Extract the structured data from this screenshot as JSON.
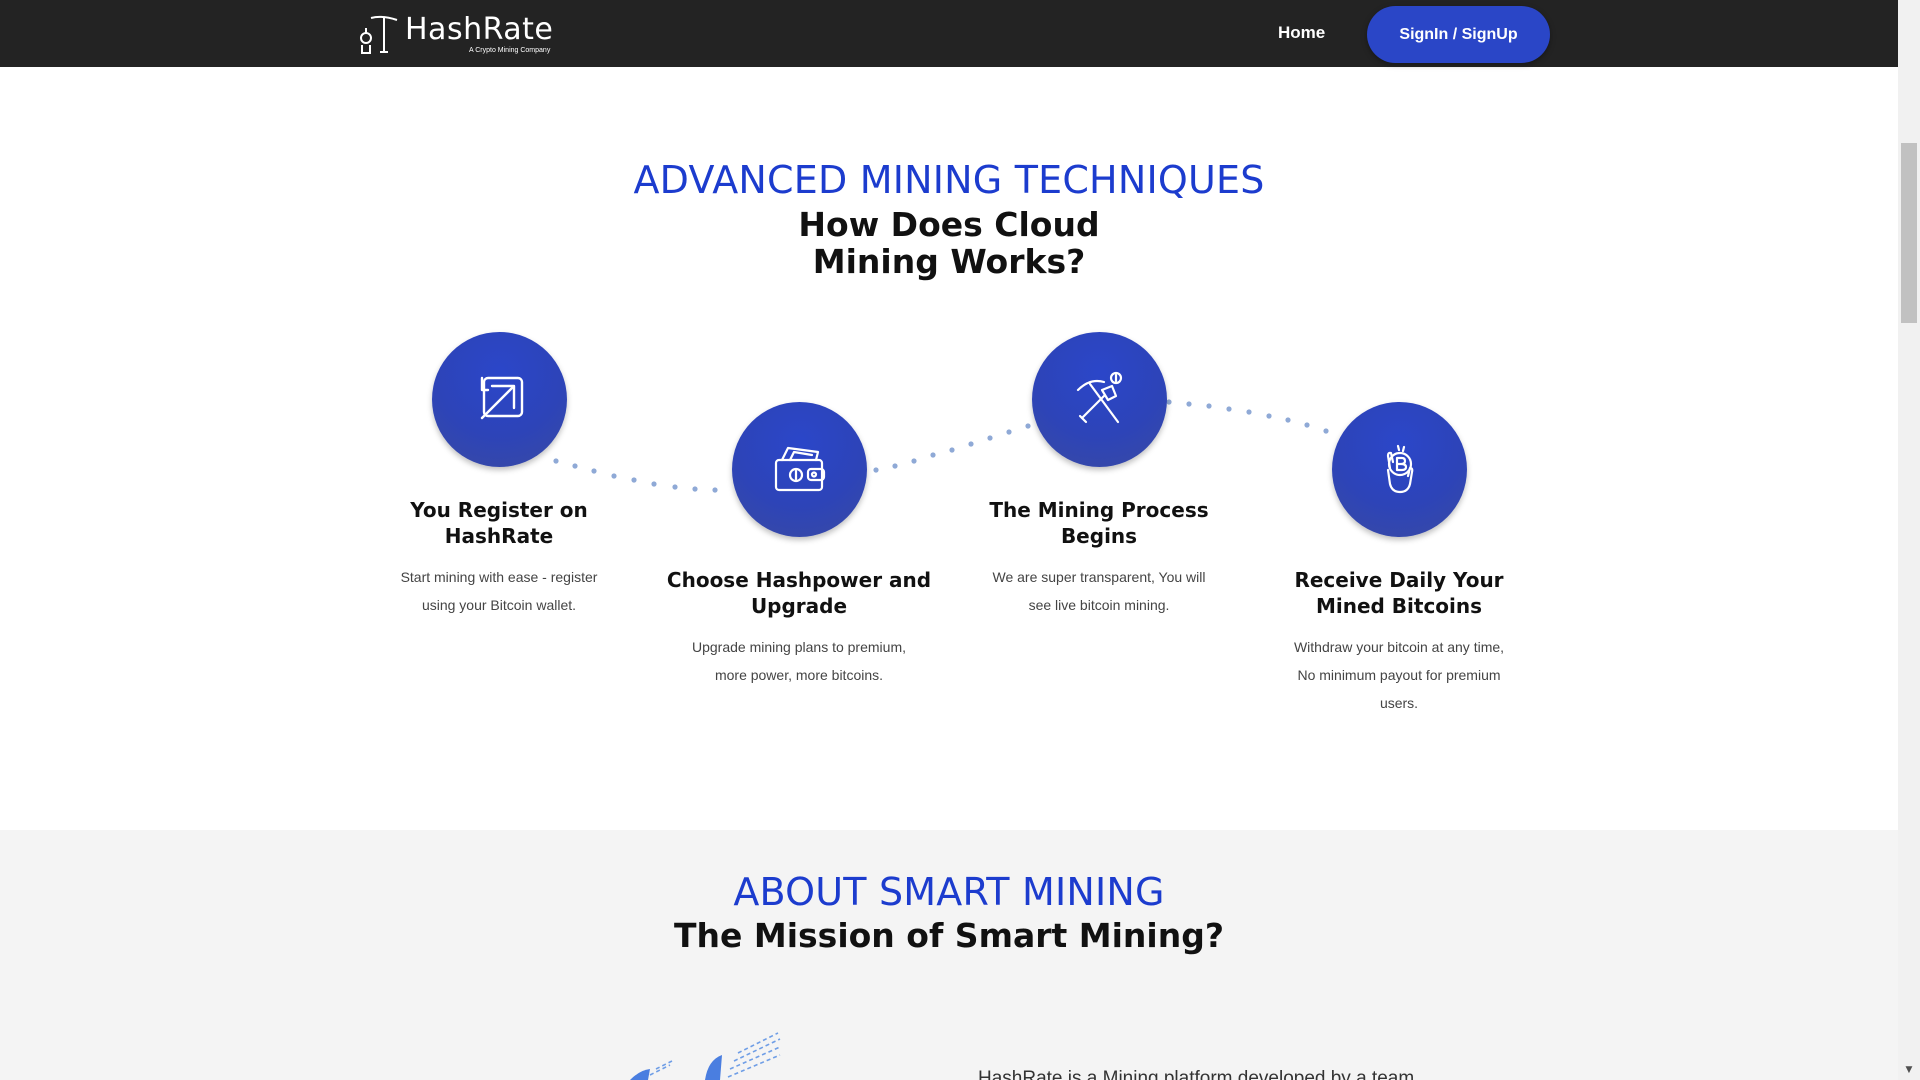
{
  "header": {
    "logo_title": "HashRate",
    "logo_tagline": "A Crypto Mining Company",
    "nav_home": "Home",
    "nav_signin": "SignIn / SignUp"
  },
  "how_it_works": {
    "kicker": "ADVANCED MINING TECHNIQUES",
    "heading_line1": "How Does Cloud",
    "heading_line2": "Mining Works?",
    "steps": [
      {
        "icon": "register-arrow-icon",
        "title": "You Register on HashRate",
        "desc": "Start mining with ease - register using your Bitcoin wallet."
      },
      {
        "icon": "wallet-icon",
        "title": "Choose Hashpower and Upgrade",
        "desc": "Upgrade mining plans to premium, more power, more bitcoins."
      },
      {
        "icon": "pickaxe-shovel-icon",
        "title": "The Mining Process Begins",
        "desc": "We are super transparent, You will see live bitcoin mining."
      },
      {
        "icon": "hand-bitcoin-icon",
        "title": "Receive Daily Your Mined Bitcoins",
        "desc": "Withdraw your bitcoin at any time, No minimum payout for premium users."
      }
    ]
  },
  "about": {
    "kicker": "ABOUT SMART MINING",
    "heading": "The Mission of Smart Mining?",
    "text_partial": "HashRate is a Mining platform developed by a team"
  },
  "colors": {
    "accent": "#1c3cce",
    "header_bg": "#232323",
    "button_bg": "#2a46c7",
    "dots": "#8fa9d6"
  }
}
